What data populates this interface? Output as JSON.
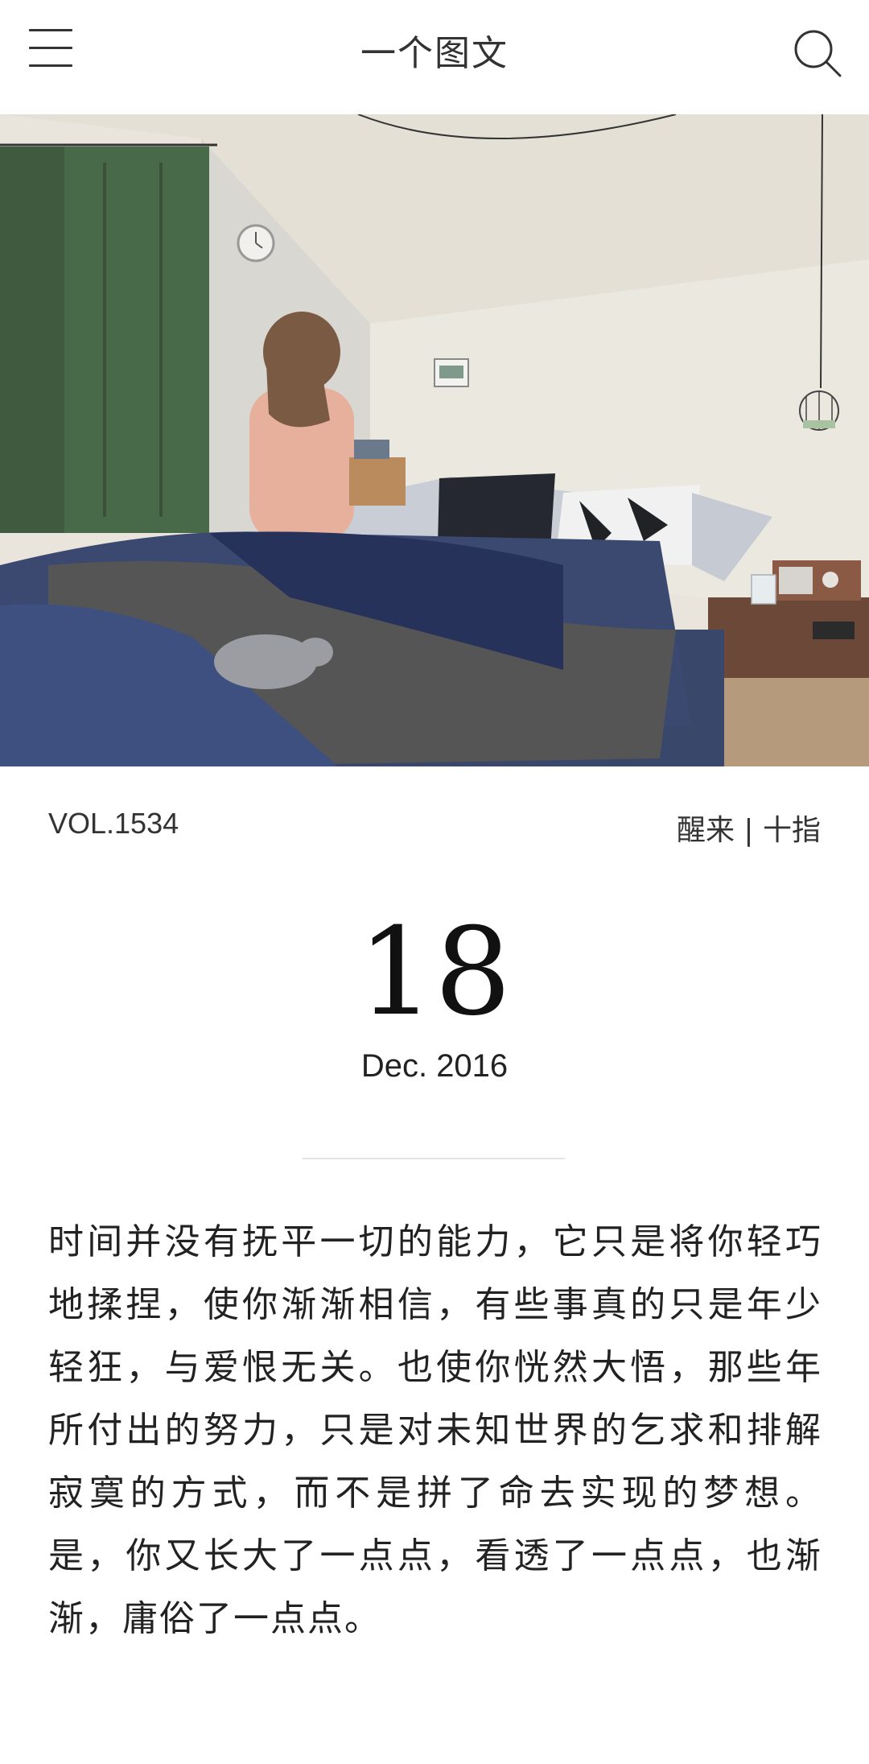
{
  "header": {
    "title": "一个图文",
    "menu_icon": "hamburger-menu-icon",
    "search_icon": "search-icon"
  },
  "illustration": {
    "subject": "illustration-bedroom-girl-sitting-on-bed"
  },
  "meta": {
    "volume": "VOL.1534",
    "author": "醒来 | 十指"
  },
  "date": {
    "day": "18",
    "month_year": "Dec. 2016"
  },
  "quote": {
    "text": "时间并没有抚平一切的能力，它只是将你轻巧地揉捏，使你渐渐相信，有些事真的只是年少轻狂，与爱恨无关。也使你恍然大悟，那些年所付出的努力，只是对未知世界的乞求和排解寂寞的方式，而不是拼了命去实现的梦想。是，你又长大了一点点，看透了一点点，也渐渐，庸俗了一点点。"
  },
  "colors": {
    "background": "#ffffff",
    "text": "#222222",
    "divider": "#e4e4e4"
  }
}
